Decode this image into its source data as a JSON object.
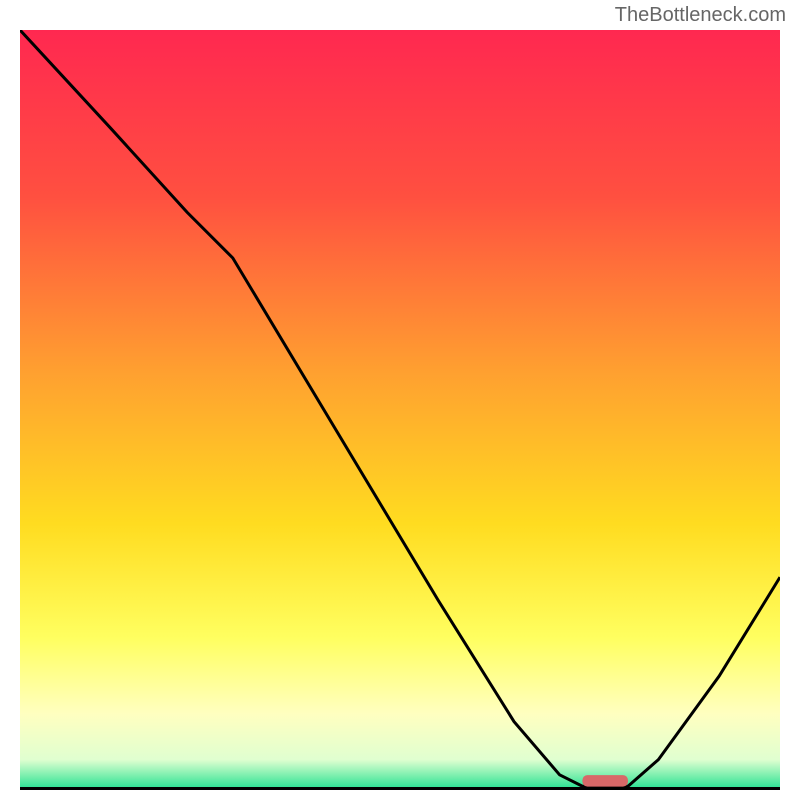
{
  "watermark": "TheBottleneck.com",
  "chart_data": {
    "type": "line",
    "title": "",
    "xlabel": "",
    "ylabel": "",
    "xlim": [
      0,
      100
    ],
    "ylim": [
      0,
      100
    ],
    "gradient_stops": [
      {
        "offset": 0,
        "color": "#ff2850"
      },
      {
        "offset": 22,
        "color": "#ff5040"
      },
      {
        "offset": 45,
        "color": "#ffa030"
      },
      {
        "offset": 65,
        "color": "#ffdc20"
      },
      {
        "offset": 80,
        "color": "#ffff60"
      },
      {
        "offset": 90,
        "color": "#ffffc0"
      },
      {
        "offset": 96,
        "color": "#e0ffd0"
      },
      {
        "offset": 100,
        "color": "#20e090"
      }
    ],
    "curve": [
      {
        "x": 0,
        "y": 100
      },
      {
        "x": 12,
        "y": 87
      },
      {
        "x": 22,
        "y": 76
      },
      {
        "x": 28,
        "y": 70
      },
      {
        "x": 40,
        "y": 50
      },
      {
        "x": 55,
        "y": 25
      },
      {
        "x": 65,
        "y": 9
      },
      {
        "x": 71,
        "y": 2
      },
      {
        "x": 74,
        "y": 0.5
      },
      {
        "x": 80,
        "y": 0.5
      },
      {
        "x": 84,
        "y": 4
      },
      {
        "x": 92,
        "y": 15
      },
      {
        "x": 100,
        "y": 28
      }
    ],
    "marker": {
      "x": 77,
      "y": 1.2,
      "width": 6,
      "height": 1.5,
      "color": "#d86868"
    },
    "annotations": []
  }
}
